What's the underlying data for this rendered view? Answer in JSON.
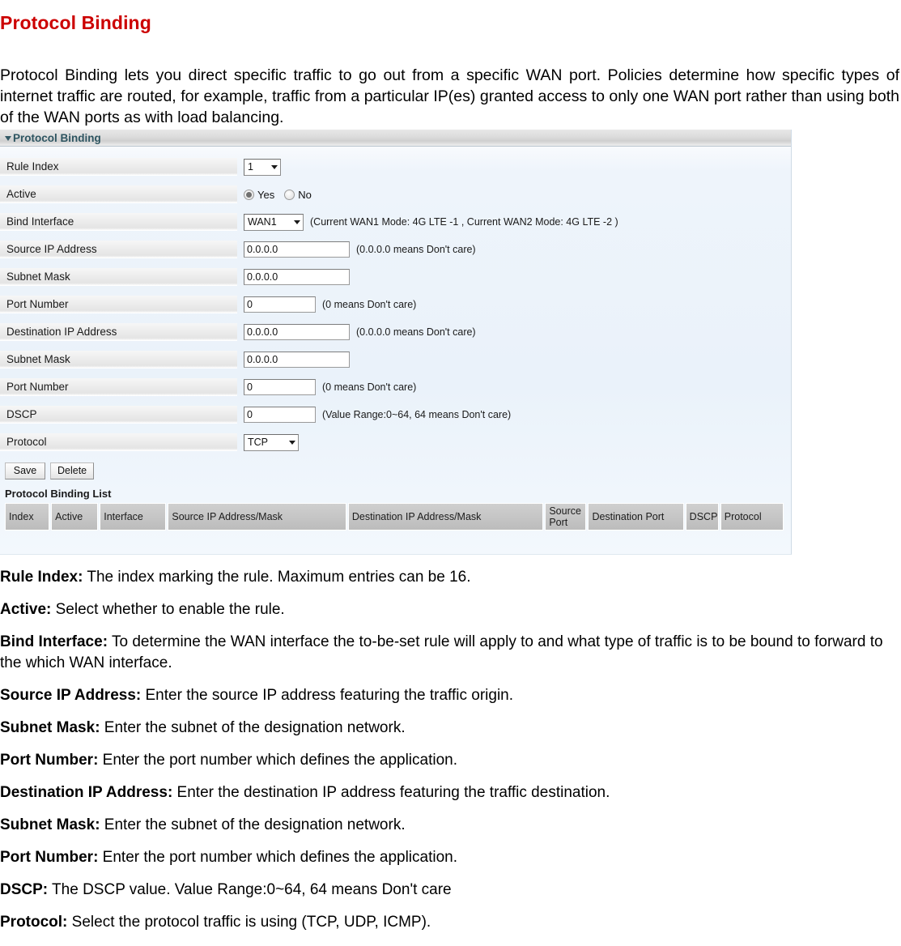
{
  "page": {
    "title": "Protocol Binding",
    "title_color": "#cc0000",
    "intro": "Protocol Binding lets you direct specific traffic to go out from a specific WAN port. Policies determine how specific types of internet traffic are routed, for example, traffic from a particular IP(es) granted access to only one WAN port rather than using both of the WAN ports as with load balancing."
  },
  "panel": {
    "header": "Protocol Binding",
    "rows": {
      "rule_index": {
        "label": "Rule Index",
        "value": "1",
        "options": [
          "1"
        ]
      },
      "active": {
        "label": "Active",
        "yes_label": "Yes",
        "no_label": "No",
        "selected": "Yes"
      },
      "bind_interface": {
        "label": "Bind Interface",
        "value": "WAN1",
        "options": [
          "WAN1"
        ],
        "hint": "(Current WAN1 Mode: 4G LTE -1 , Current WAN2 Mode: 4G LTE -2 )"
      },
      "source_ip": {
        "label": "Source IP Address",
        "value": "0.0.0.0",
        "hint": "(0.0.0.0 means Don't care)"
      },
      "source_mask": {
        "label": "Subnet Mask",
        "value": "0.0.0.0",
        "hint": ""
      },
      "source_port": {
        "label": "Port Number",
        "value": "0",
        "hint": "(0 means Don't care)"
      },
      "dest_ip": {
        "label": "Destination IP Address",
        "value": "0.0.0.0",
        "hint": "(0.0.0.0 means Don't care)"
      },
      "dest_mask": {
        "label": "Subnet Mask",
        "value": "0.0.0.0",
        "hint": ""
      },
      "dest_port": {
        "label": "Port Number",
        "value": "0",
        "hint": "(0 means Don't care)"
      },
      "dscp": {
        "label": "DSCP",
        "value": "0",
        "hint": "(Value Range:0~64, 64 means Don't care)"
      },
      "protocol": {
        "label": "Protocol",
        "value": "TCP",
        "options": [
          "TCP",
          "UDP",
          "ICMP"
        ]
      }
    },
    "buttons": {
      "save": "Save",
      "delete": "Delete"
    },
    "list": {
      "title": "Protocol Binding List",
      "columns": [
        "Index",
        "Active",
        "Interface",
        "Source IP Address/Mask",
        "Destination IP Address/Mask",
        "Source Port",
        "Destination Port",
        "DSCP",
        "Protocol"
      ],
      "rows": []
    }
  },
  "definitions": [
    {
      "term": "Rule Index:",
      "desc": " The index marking the rule. Maximum entries can be 16."
    },
    {
      "term": "Active:",
      "desc": " Select whether to enable the rule."
    },
    {
      "term": "Bind Interface:",
      "desc": " To determine the WAN interface the to-be-set rule will apply to and what type of traffic is to be bound to forward to the which WAN interface."
    },
    {
      "term": "Source IP Address:",
      "desc": " Enter the source IP address featuring the traffic origin."
    },
    {
      "term": "Subnet Mask:",
      "desc": " Enter the subnet of the designation network."
    },
    {
      "term": "Port Number:",
      "desc": " Enter the port number which defines the application."
    },
    {
      "term": "Destination IP Address:",
      "desc": " Enter the destination IP address featuring the traffic destination."
    },
    {
      "term": "Subnet Mask:",
      "desc": " Enter the subnet of the designation network."
    },
    {
      "term": "Port Number:",
      "desc": " Enter the port number which defines the application."
    },
    {
      "term": "DSCP:",
      "desc": " The DSCP value. Value Range:0~64, 64 means Don't care"
    },
    {
      "term": "Protocol:",
      "desc": " Select the protocol traffic is using (TCP, UDP, ICMP)."
    }
  ]
}
